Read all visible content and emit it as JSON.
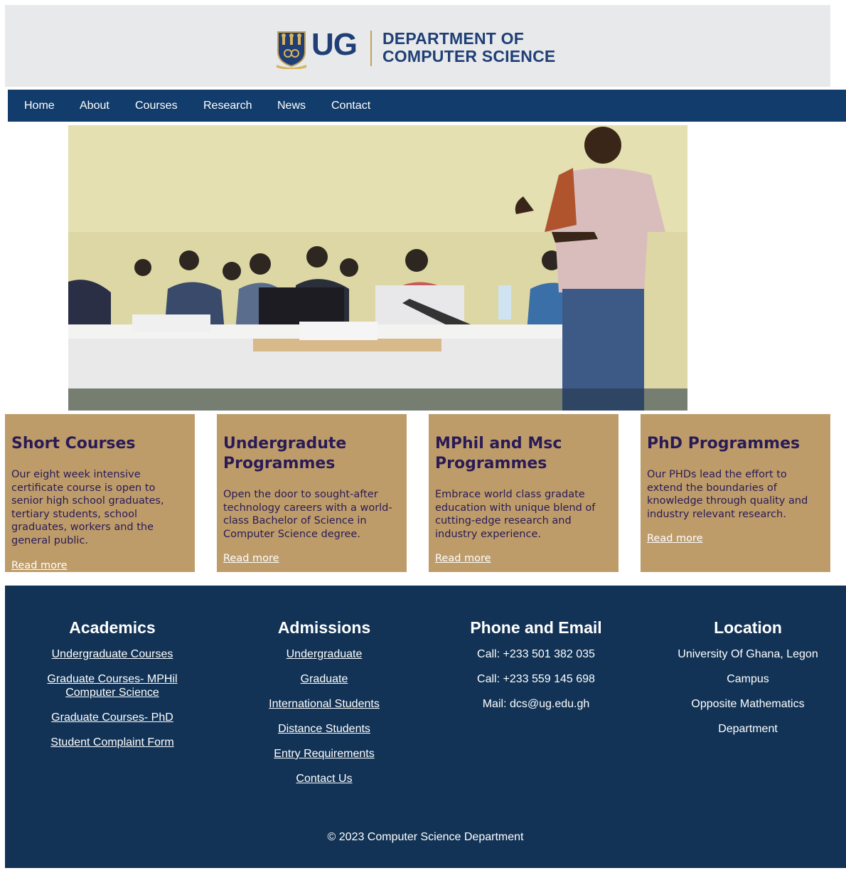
{
  "header": {
    "logo_text": "UG",
    "dept_line1": "DEPARTMENT OF",
    "dept_line2": "COMPUTER SCIENCE",
    "brand_color": "#1f3f76",
    "accent_color": "#c4a05a"
  },
  "nav": {
    "items": [
      "Home",
      "About",
      "Courses",
      "Research",
      "News",
      "Contact"
    ],
    "background": "#123c6b"
  },
  "hero": {
    "icon": "classroom-photo"
  },
  "cards": [
    {
      "title": "Short Courses",
      "body": "Our eight week intensive certificate course is open to senior high school graduates, tertiary students, school graduates, workers and the general public.",
      "link": "Read more"
    },
    {
      "title": "Undergradute Programmes",
      "body": "Open the door to sought-after technology careers with a world-class Bachelor of Science in Computer Science degree.",
      "link": "Read more"
    },
    {
      "title": "MPhil and Msc Programmes",
      "body": "Embrace world class gradate education with unique blend of cutting-edge research and industry experience.",
      "link": "Read more"
    },
    {
      "title": "PhD Programmes",
      "body": "Our PHDs lead the effort to extend the boundaries of knowledge through quality and industry relevant research.",
      "link": "Read more"
    }
  ],
  "footer": {
    "academics": {
      "title": "Academics",
      "links": [
        "Undergraduate Courses",
        "Graduate Courses- MPHil Computer Science",
        "Graduate Courses- PhD",
        "Student Complaint Form"
      ]
    },
    "admissions": {
      "title": "Admissions",
      "links": [
        "Undergraduate",
        "Graduate",
        "International Students",
        "Distance Students",
        "Entry Requirements",
        "Contact Us"
      ]
    },
    "contact": {
      "title": "Phone and Email",
      "lines": [
        "Call: +233 501 382 035",
        "Call: +233 559 145 698",
        "Mail: dcs@ug.edu.gh"
      ]
    },
    "location": {
      "title": "Location",
      "lines": [
        "University Of Ghana, Legon",
        "Campus",
        "Opposite Mathematics",
        "Department"
      ]
    },
    "copyright": "© 2023 Computer Science Department",
    "background": "#123356"
  }
}
